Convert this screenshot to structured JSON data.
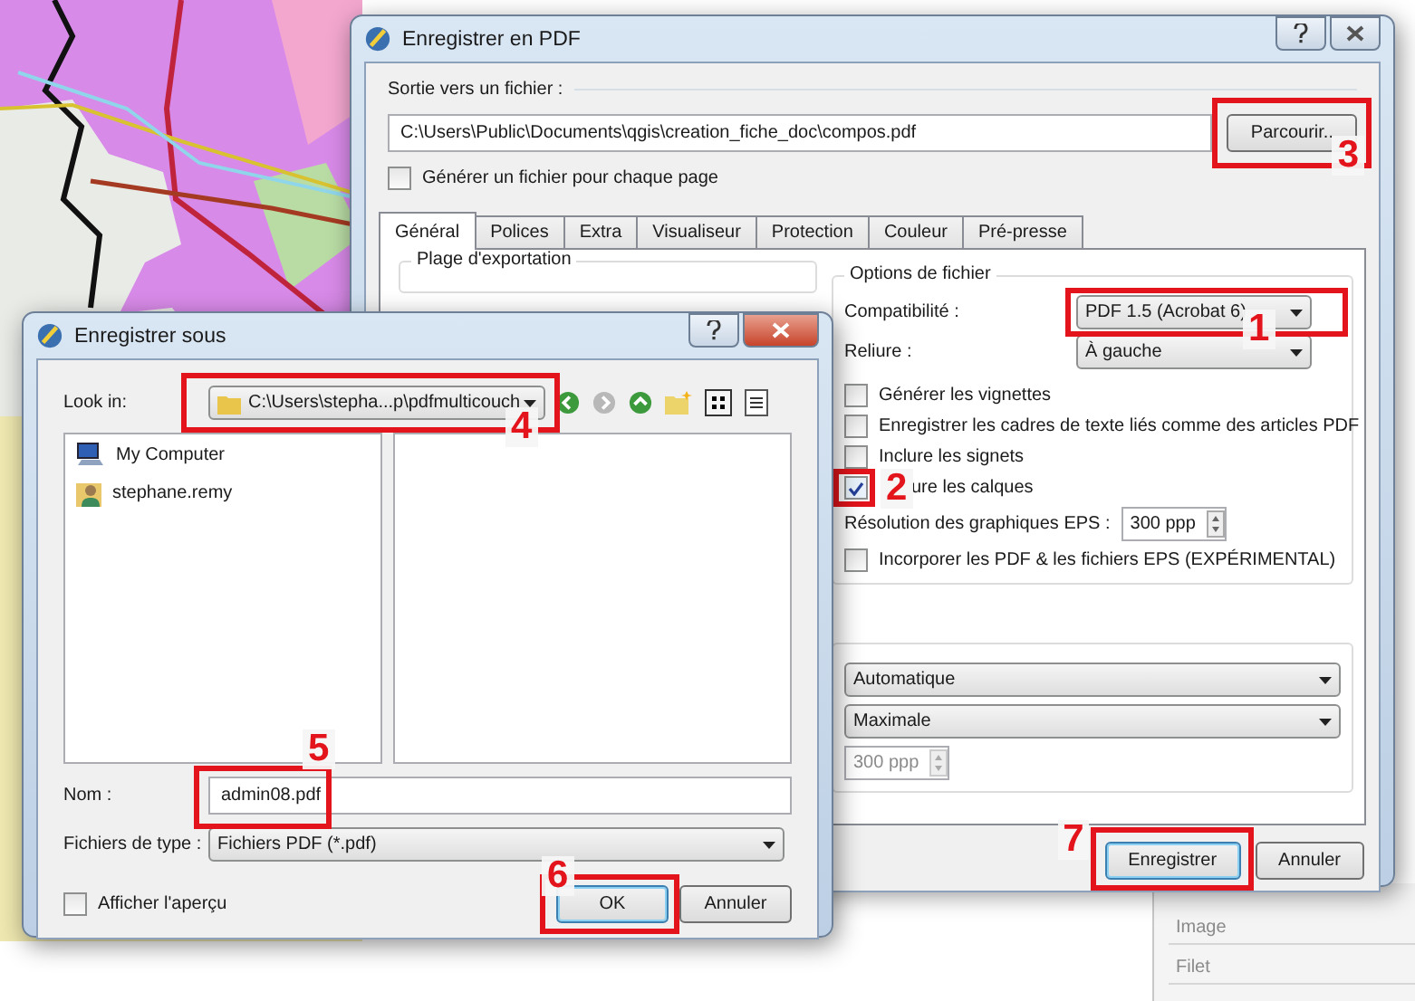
{
  "background_panel": {
    "rows": [
      {
        "label": "Image"
      },
      {
        "label": "Filet"
      }
    ]
  },
  "pdf_dialog": {
    "title": "Enregistrer en PDF",
    "output": {
      "label": "Sortie vers un fichier :",
      "path": "C:\\Users\\Public\\Documents\\qgis\\creation_fiche_doc\\compos.pdf",
      "browse": "Parcourir..",
      "browse_annotation": "3"
    },
    "per_page": {
      "label": "Générer un fichier pour chaque page",
      "checked": false
    },
    "tabs": [
      {
        "label": "Général",
        "selected": true
      },
      {
        "label": "Polices",
        "selected": false
      },
      {
        "label": "Extra",
        "selected": false
      },
      {
        "label": "Visualiseur",
        "selected": false
      },
      {
        "label": "Protection",
        "selected": false
      },
      {
        "label": "Couleur",
        "selected": false
      },
      {
        "label": "Pré-presse",
        "selected": false
      }
    ],
    "export_range": {
      "title": "Plage d'exportation"
    },
    "file_options": {
      "title": "Options de fichier",
      "fields": [
        {
          "label": "Compatibilité :",
          "value": "PDF 1.5 (Acrobat 6)",
          "annotation": "1"
        },
        {
          "label": "Reliure :",
          "value": "À gauche"
        }
      ],
      "rows": [
        {
          "kind": "checkbox",
          "label": "Générer les vignettes",
          "checked": false
        },
        {
          "kind": "checkbox",
          "label": "Enregistrer les cadres de texte liés comme des articles PDF",
          "checked": false
        },
        {
          "kind": "checkbox",
          "label": "Inclure les signets",
          "checked": false
        },
        {
          "kind": "checkbox",
          "label": "ure les calques",
          "checked": true,
          "annotation": "2"
        },
        {
          "kind": "spin",
          "label": "Résolution des graphiques EPS :",
          "value": "300 ppp"
        },
        {
          "kind": "checkbox",
          "label": "Incorporer les PDF & les fichiers EPS (EXPÉRIMENTAL)",
          "checked": false
        }
      ]
    },
    "image_options": {
      "combos": [
        "Automatique",
        "Maximale"
      ],
      "resolution": {
        "value": "300 ppp",
        "disabled": true
      }
    },
    "buttons": [
      {
        "label": "Enregistrer",
        "default": true,
        "annotation": "7"
      },
      {
        "label": "Annuler",
        "default": false
      }
    ]
  },
  "save_dialog": {
    "title": "Enregistrer sous",
    "look_in": {
      "label": "Look in:",
      "value": "C:\\Users\\stepha...p\\pdfmulticouch",
      "annotation": "4"
    },
    "places": [
      {
        "kind": "computer",
        "label": "My Computer"
      },
      {
        "kind": "user",
        "label": "stephane.remy"
      }
    ],
    "name": {
      "label": "Nom :",
      "value": "admin08.pdf",
      "annotation": "5"
    },
    "type": {
      "label": "Fichiers de type :",
      "value": "Fichiers PDF (*.pdf)"
    },
    "preview": {
      "label": "Afficher l'aperçu",
      "checked": false
    },
    "buttons": [
      {
        "label": "OK",
        "default": true,
        "annotation": "6"
      },
      {
        "label": "Annuler",
        "default": false
      }
    ]
  }
}
